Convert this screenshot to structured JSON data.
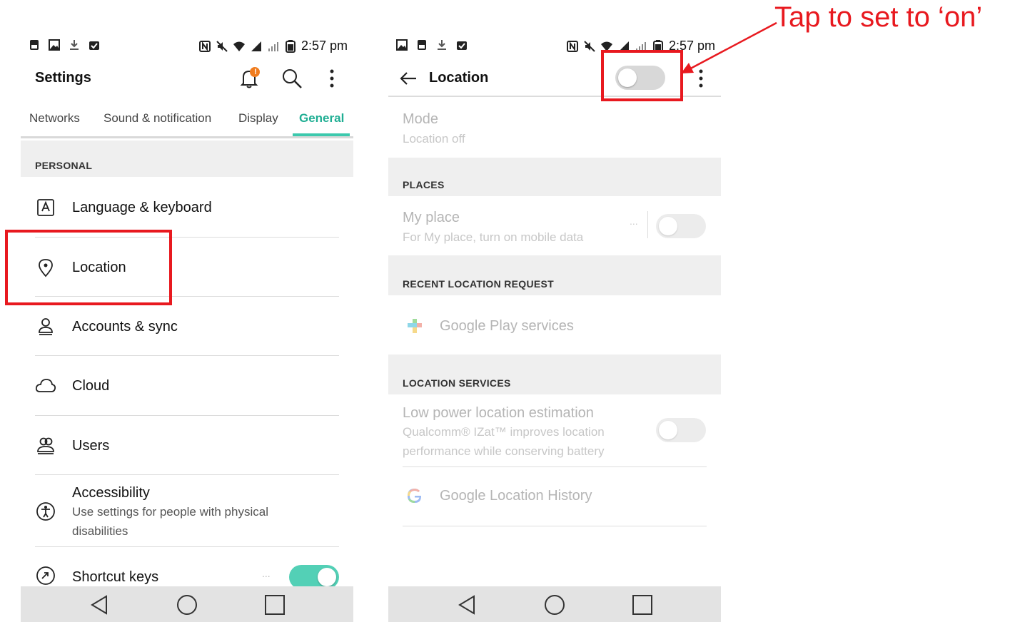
{
  "annotation": {
    "text": "Tap to set to ‘on’",
    "color": "#e8191f"
  },
  "colors": {
    "accent": "#1fae93",
    "toggle_on": "#53d0b6",
    "highlight": "#e8191f"
  },
  "status": {
    "time": "2:57 pm"
  },
  "settings": {
    "title": "Settings",
    "notification_badge": "!",
    "tabs": [
      "Networks",
      "Sound & notification",
      "Display",
      "General"
    ],
    "active_tab": "General",
    "section": "PERSONAL",
    "items": [
      {
        "label": "Language & keyboard",
        "icon": "language-icon"
      },
      {
        "label": "Location",
        "icon": "location-pin-icon"
      },
      {
        "label": "Accounts & sync",
        "icon": "account-icon"
      },
      {
        "label": "Cloud",
        "icon": "cloud-icon"
      },
      {
        "label": "Users",
        "icon": "users-icon"
      },
      {
        "label": "Accessibility",
        "sub": "Use settings for people with physical disabilities",
        "icon": "accessibility-icon"
      },
      {
        "label": "Shortcut keys",
        "icon": "shortcut-icon",
        "more": "...",
        "toggle_on": true
      }
    ]
  },
  "location": {
    "title": "Location",
    "master_toggle_on": false,
    "mode": {
      "label": "Mode",
      "value": "Location off"
    },
    "places_header": "PLACES",
    "my_place": {
      "label": "My place",
      "sub": "For My place, turn on mobile data",
      "more": "..."
    },
    "recent_header": "RECENT LOCATION REQUEST",
    "recent_app": "Google Play services",
    "services_header": "LOCATION SERVICES",
    "low_power": {
      "label": "Low power location estimation",
      "sub": "Qualcomm® IZat™ improves location performance while conserving battery"
    },
    "history": "Google Location History"
  }
}
